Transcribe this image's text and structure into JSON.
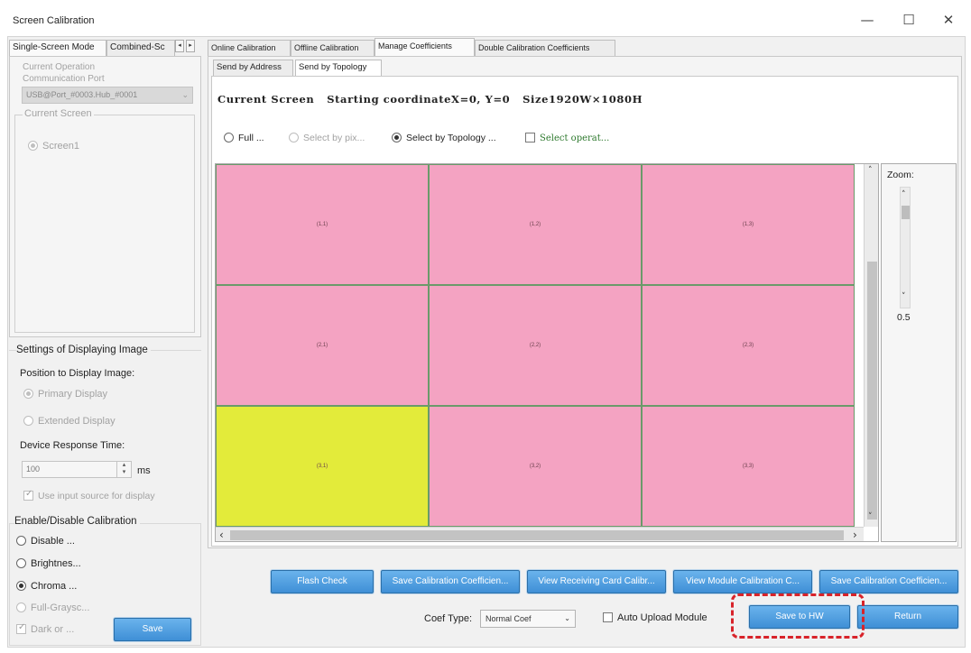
{
  "window": {
    "title": "Screen Calibration",
    "minimize": "—",
    "maximize": "☐",
    "close": "✕"
  },
  "left_tabs": {
    "single": "Single-Screen Mode",
    "combined": "Combined-Sc",
    "arrow_left": "◂",
    "arrow_right": "▸"
  },
  "current_operation": {
    "label_line1": "Current Operation",
    "label_line2": "Communication Port",
    "port_value": "USB@Port_#0003.Hub_#0001",
    "port_arrow": "⌄"
  },
  "current_screen": {
    "legend": "Current Screen",
    "screen_item": "Screen1"
  },
  "display_settings": {
    "legend": "Settings of Displaying Image",
    "position_label": "Position to Display Image:",
    "primary": "Primary Display",
    "extended": "Extended Display",
    "response_label": "Device Response Time:",
    "response_value": "100",
    "response_unit": "ms",
    "use_input_source": "Use input source for display"
  },
  "calibration": {
    "legend": "Enable/Disable Calibration",
    "disable": "Disable ...",
    "brightness": "Brightnes...",
    "chroma": "Chroma ...",
    "full_grayscale": "Full-Graysc...",
    "dark_or": "Dark or ...",
    "save": "Save"
  },
  "right_tabs": [
    "Online Calibration",
    "Offline Calibration",
    "Manage Coefficients",
    "Double Calibration Coefficients"
  ],
  "sub_tabs": [
    "Send by Address",
    "Send by Topology"
  ],
  "current_screen_info": "Current Screen   Starting coordinateX=0, Y=0   Size1920W×1080H",
  "selection_modes": {
    "full": "Full ...",
    "by_pixel": "Select by pix...",
    "by_topology": "Select by Topology ...",
    "select_operation": "Select operat..."
  },
  "topology_cells": [
    {
      "label": "(1,1)",
      "color": "#f4a3c2"
    },
    {
      "label": "(1,2)",
      "color": "#f4a3c2"
    },
    {
      "label": "(1,3)",
      "color": "#f4a3c2"
    },
    {
      "label": "(2,1)",
      "color": "#f4a3c2"
    },
    {
      "label": "(2,2)",
      "color": "#f4a3c2"
    },
    {
      "label": "(2,3)",
      "color": "#f4a3c2"
    },
    {
      "label": "(3,1)",
      "color": "#e3eb3a"
    },
    {
      "label": "(3,2)",
      "color": "#f4a3c2"
    },
    {
      "label": "(3,3)",
      "color": "#f4a3c2"
    }
  ],
  "scroll_arrows": {
    "up": "˄",
    "down": "˅",
    "left": "‹",
    "right": "›"
  },
  "zoom": {
    "label": "Zoom:",
    "value": "0.5",
    "up": "˄",
    "down": "˅"
  },
  "action_buttons": {
    "flash_check": "Flash Check",
    "save_calib_coef": "Save Calibration Coefficien...",
    "view_receiving": "View Receiving Card Calibr...",
    "view_module": "View Module Calibration C...",
    "save_calib_coef2": "Save Calibration Coefficien..."
  },
  "bottom": {
    "coef_type_label": "Coef Type:",
    "coef_type_value": "Normal Coef",
    "coef_type_arrow": "⌄",
    "auto_upload": "Auto Upload Module",
    "save_to_hw": "Save to HW",
    "return": "Return"
  },
  "colors": {
    "pink_cell": "#f4a3c2",
    "yellow_cell": "#e3eb3a",
    "blue_button": "#3f8fd6",
    "highlight": "#d8232a"
  }
}
